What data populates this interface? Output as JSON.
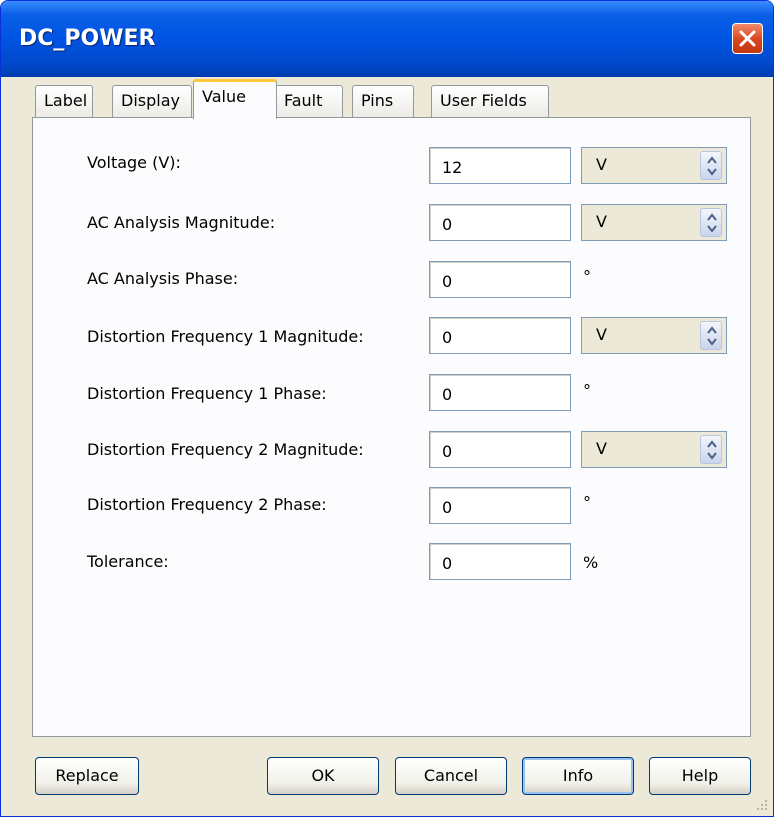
{
  "window": {
    "title": "DC_POWER"
  },
  "tabs": [
    {
      "label": "Label"
    },
    {
      "label": "Display"
    },
    {
      "label": "Value"
    },
    {
      "label": "Fault"
    },
    {
      "label": "Pins"
    },
    {
      "label": "User Fields"
    }
  ],
  "active_tab": "Value",
  "fields": [
    {
      "label": "Voltage (V):",
      "value": "12",
      "unit": "V"
    },
    {
      "label": "AC Analysis Magnitude:",
      "value": "0",
      "unit": "V"
    },
    {
      "label": "AC Analysis Phase:",
      "value": "0",
      "suffix": "°"
    },
    {
      "label": "Distortion Frequency 1 Magnitude:",
      "value": "0",
      "unit": "V"
    },
    {
      "label": "Distortion Frequency 1 Phase:",
      "value": "0",
      "suffix": "°"
    },
    {
      "label": "Distortion Frequency 2 Magnitude:",
      "value": "0",
      "unit": "V"
    },
    {
      "label": "Distortion Frequency 2 Phase:",
      "value": "0",
      "suffix": "°"
    },
    {
      "label": "Tolerance:",
      "value": "0",
      "suffix": "%"
    }
  ],
  "buttons": {
    "replace": "Replace",
    "ok": "OK",
    "cancel": "Cancel",
    "info": "Info",
    "help": "Help"
  },
  "colors": {
    "titlebar": "#0054e3",
    "close_button": "#d8461d",
    "active_tab_accent": "#ffc83c",
    "dialog_face": "#ece9d8"
  }
}
